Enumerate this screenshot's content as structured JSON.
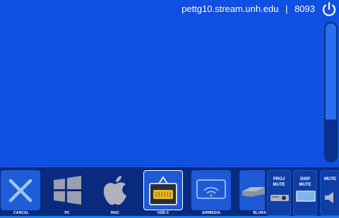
{
  "header": {
    "host": "pettg10.stream.unh.edu",
    "separator": "|",
    "room_number": "8093"
  },
  "volume": {
    "level": 0.3
  },
  "sources": [
    {
      "label": "CANCEL",
      "icon": "cancel-icon",
      "selected": false
    },
    {
      "label": "PC",
      "icon": "windows-icon",
      "selected": false
    },
    {
      "label": "MAC",
      "icon": "apple-icon",
      "selected": false
    },
    {
      "label": "USB-C",
      "icon": "usb-c-icon",
      "selected": true
    },
    {
      "label": "AIRMEDIA",
      "icon": "airmedia-icon",
      "selected": false
    },
    {
      "label": "BLURA",
      "icon": "bluray-icon",
      "selected": false
    }
  ],
  "mute_controls": [
    {
      "line1": "PROJ",
      "line2": "MUTE"
    },
    {
      "line1": "DISP",
      "line2": "MUTE"
    },
    {
      "line1": "MUTE",
      "line2": ""
    }
  ],
  "colors": {
    "background": "#1050e0",
    "bar": "#0a2a80",
    "accent": "#1f7cf0"
  }
}
